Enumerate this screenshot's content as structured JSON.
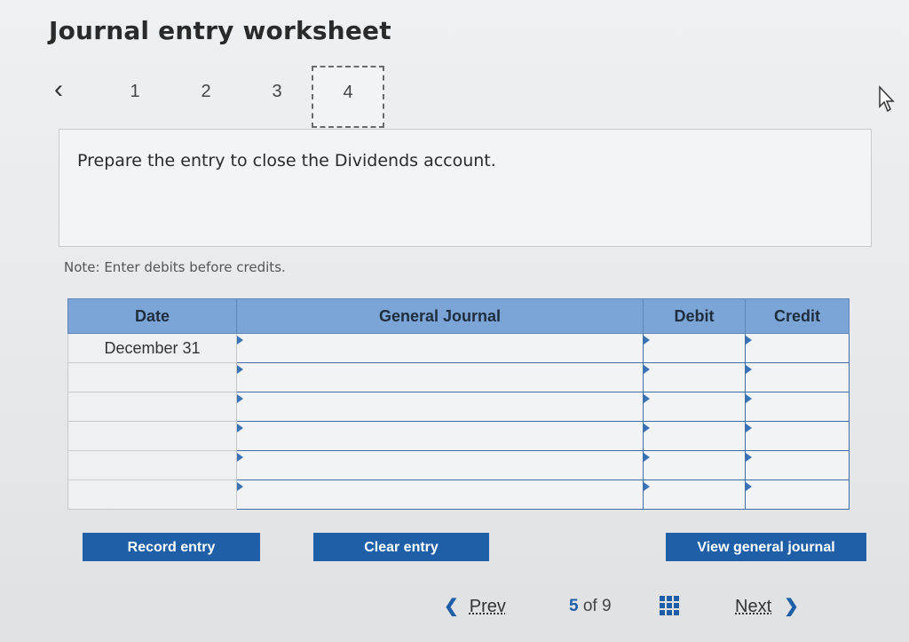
{
  "header": {
    "title": "Journal entry worksheet"
  },
  "steps": {
    "items": [
      "1",
      "2",
      "3",
      "4"
    ],
    "active": "4"
  },
  "prompt": {
    "text": "Prepare the entry to close the Dividends account."
  },
  "note": {
    "text": "Note: Enter debits before credits."
  },
  "journal": {
    "columns": {
      "date": "Date",
      "account": "General Journal",
      "debit": "Debit",
      "credit": "Credit"
    },
    "rows": [
      {
        "date": "December 31",
        "account": "",
        "debit": "",
        "credit": ""
      },
      {
        "date": "",
        "account": "",
        "debit": "",
        "credit": ""
      },
      {
        "date": "",
        "account": "",
        "debit": "",
        "credit": ""
      },
      {
        "date": "",
        "account": "",
        "debit": "",
        "credit": ""
      },
      {
        "date": "",
        "account": "",
        "debit": "",
        "credit": ""
      },
      {
        "date": "",
        "account": "",
        "debit": "",
        "credit": ""
      }
    ]
  },
  "buttons": {
    "record": "Record entry",
    "clear": "Clear entry",
    "view": "View general journal"
  },
  "pager": {
    "prev": "Prev",
    "current": "5",
    "of": "of",
    "total": "9",
    "next": "Next"
  },
  "colors": {
    "header_blue": "#7aa5d6",
    "button_blue": "#1f5fa8"
  }
}
